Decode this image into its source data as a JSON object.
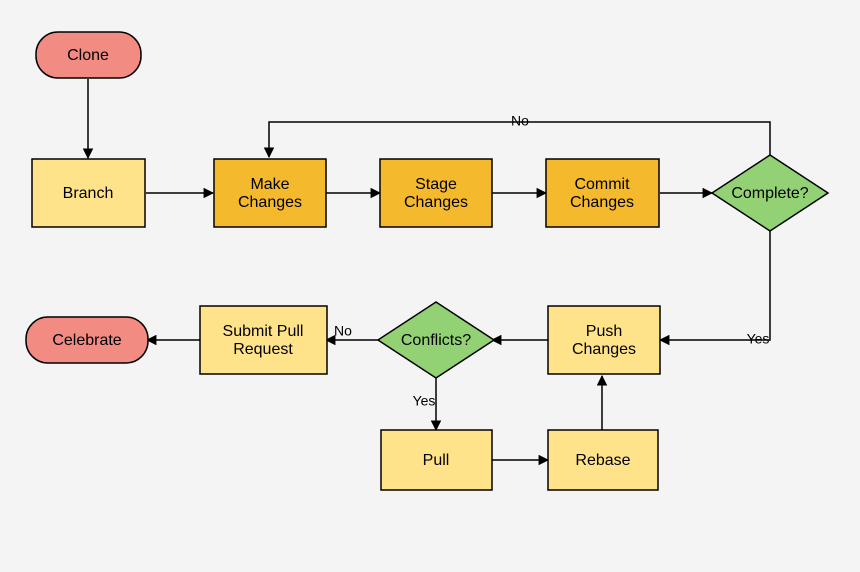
{
  "nodes": {
    "clone": "Clone",
    "branch": "Branch",
    "make": "Make Changes",
    "stage": "Stage Changes",
    "commit": "Commit Changes",
    "complete": "Complete?",
    "push": "Push Changes",
    "conflicts": "Conflicts?",
    "submitPR1": "Submit Pull",
    "submitPR2": "Request",
    "celebrate": "Celebrate",
    "pull": "Pull",
    "rebase": "Rebase"
  },
  "edges": {
    "no1": "No",
    "yes1": "Yes",
    "no2": "No",
    "yes2": "Yes"
  }
}
